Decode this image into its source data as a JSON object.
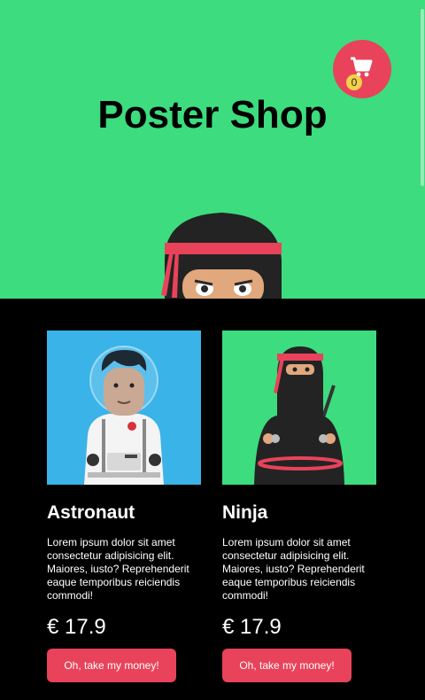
{
  "header": {
    "title": "Poster Shop",
    "cart_count": "0"
  },
  "colors": {
    "hero_bg": "#3ddc7e",
    "accent": "#e8435a",
    "badge": "#f3d24a",
    "page_bg": "#000000"
  },
  "products": [
    {
      "name": "Astronaut",
      "description": "Lorem ipsum dolor sit amet consectetur adipisicing elit. Maiores, iusto? Reprehenderit eaque temporibus reiciendis commodi!",
      "price": "€ 17.9",
      "button_label": "Oh, take my money!",
      "image_icon": "astronaut-illustration"
    },
    {
      "name": "Ninja",
      "description": "Lorem ipsum dolor sit amet consectetur adipisicing elit. Maiores, iusto? Reprehenderit eaque temporibus reiciendis commodi!",
      "price": "€ 17.9",
      "button_label": "Oh, take my money!",
      "image_icon": "ninja-illustration"
    }
  ]
}
